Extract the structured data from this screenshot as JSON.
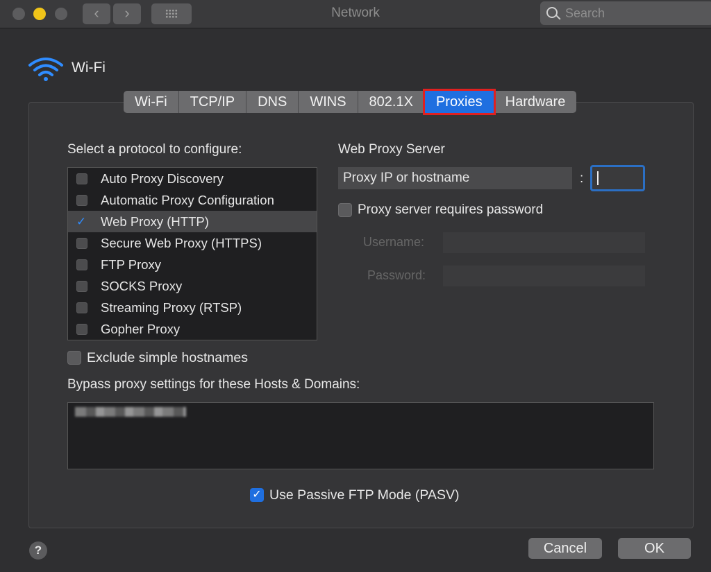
{
  "window": {
    "title": "Network",
    "search_placeholder": "Search"
  },
  "header": {
    "interface_name": "Wi-Fi",
    "icon": "wifi-icon"
  },
  "tabs": [
    {
      "label": "Wi-Fi",
      "active": false
    },
    {
      "label": "TCP/IP",
      "active": false
    },
    {
      "label": "DNS",
      "active": false
    },
    {
      "label": "WINS",
      "active": false
    },
    {
      "label": "802.1X",
      "active": false
    },
    {
      "label": "Proxies",
      "active": true
    },
    {
      "label": "Hardware",
      "active": false
    }
  ],
  "protocols": {
    "heading": "Select a protocol to configure:",
    "items": [
      {
        "label": "Auto Proxy Discovery",
        "checked": false
      },
      {
        "label": "Automatic Proxy Configuration",
        "checked": false
      },
      {
        "label": "Web Proxy (HTTP)",
        "checked": true
      },
      {
        "label": "Secure Web Proxy (HTTPS)",
        "checked": false
      },
      {
        "label": "FTP Proxy",
        "checked": false
      },
      {
        "label": "SOCKS Proxy",
        "checked": false
      },
      {
        "label": "Streaming Proxy (RTSP)",
        "checked": false
      },
      {
        "label": "Gopher Proxy",
        "checked": false
      }
    ]
  },
  "proxy_server": {
    "heading": "Web Proxy Server",
    "host_placeholder": "Proxy IP or hostname",
    "separator": ":",
    "requires_password_label": "Proxy server requires password",
    "username_label": "Username:",
    "password_label": "Password:"
  },
  "exclude_simple_hostnames": {
    "label": "Exclude simple hostnames",
    "checked": false
  },
  "bypass": {
    "heading": "Bypass proxy settings for these Hosts & Domains:"
  },
  "passive_ftp": {
    "label": "Use Passive FTP Mode (PASV)",
    "checked": true
  },
  "footer": {
    "help_label": "?",
    "cancel_label": "Cancel",
    "ok_label": "OK"
  },
  "colors": {
    "accent": "#1f6fe0",
    "highlight_outline": "#e02020",
    "traffic_yellow": "#f0c419"
  }
}
